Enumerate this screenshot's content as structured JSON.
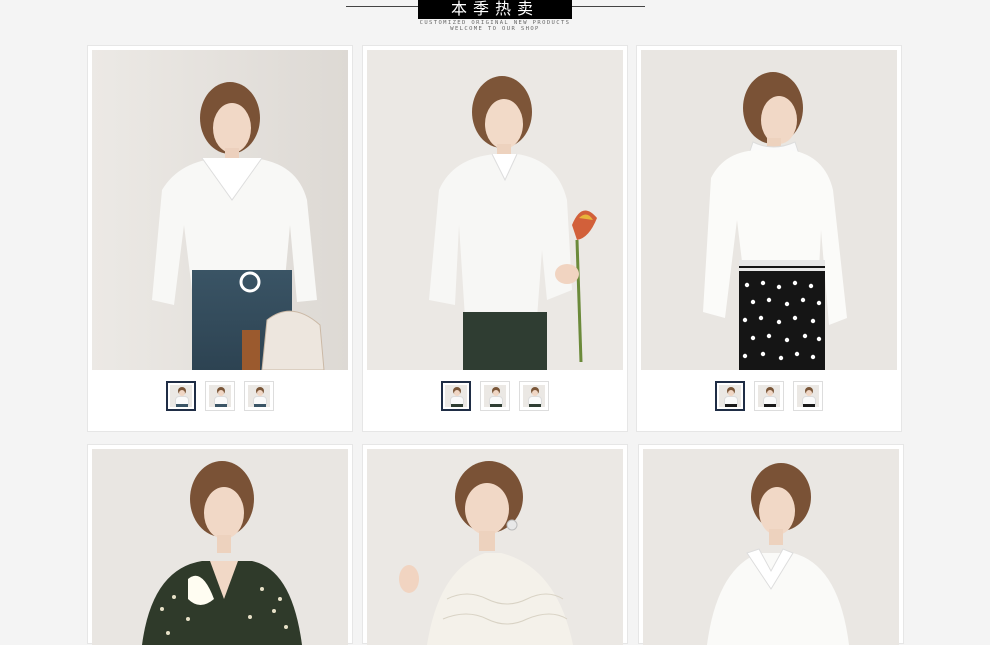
{
  "header": {
    "title": "本季热卖",
    "subtitle_line1": "CUSTOMIZED ORIGINAL NEW PRODUCTS",
    "subtitle_line2": "WELCOME TO OUR SHOP"
  },
  "products": [
    {
      "name": "white-sheer-collar-blouse",
      "skirt_color": "#3a5465",
      "active_thumb": 1
    },
    {
      "name": "white-ruched-tie-blouse",
      "skirt_color": "#2f3d32",
      "active_thumb": 1
    },
    {
      "name": "white-ruffle-neck-blouse",
      "skirt_color": "#1a1a1a",
      "active_thumb": 1
    },
    {
      "name": "floral-vneck-blouse",
      "skirt_color": "#2a2a2a"
    },
    {
      "name": "lace-blouse",
      "skirt_color": "#f0ece6"
    },
    {
      "name": "white-collar-shirt",
      "skirt_color": "#f7f7f7"
    }
  ],
  "colors": {
    "background": "#f4f4f4",
    "title_box": "#000000",
    "active_thumb_border": "#1f2d45"
  }
}
